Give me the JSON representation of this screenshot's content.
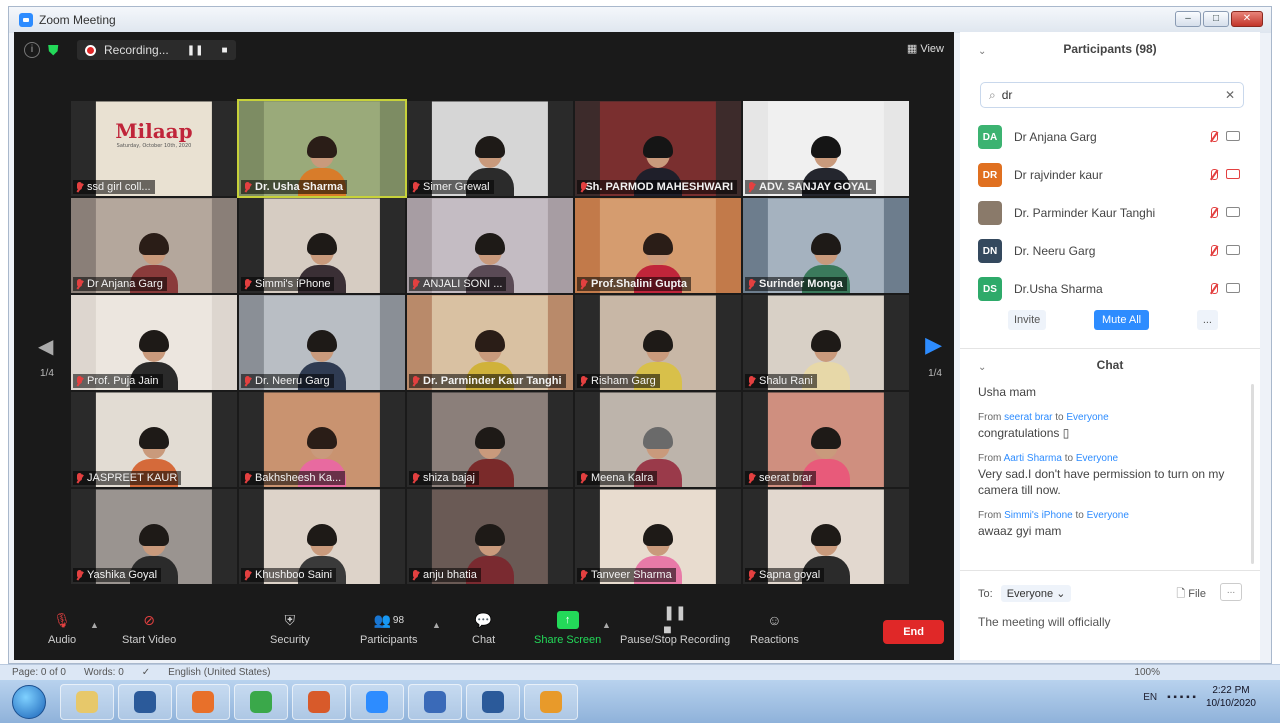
{
  "window": {
    "title": "Zoom Meeting"
  },
  "topbar": {
    "recording_label": "Recording...",
    "view_label": "View"
  },
  "grid": {
    "page_left": "1/4",
    "page_right": "1/4",
    "tiles": [
      {
        "name": "ssd girl coll...",
        "bold": false,
        "active": false,
        "bg": "#2a2a2a",
        "photo": "#e9e1d2",
        "body": "#b84c7c",
        "hair": "#2a1d17",
        "poster_text": "Milaap",
        "poster_sub": "Saturday, October 10th, 2020"
      },
      {
        "name": "Dr. Usha Sharma",
        "bold": true,
        "active": true,
        "bg": "#7d8c63",
        "photo": "#9aaa7a",
        "body": "#d87c2a",
        "hair": "#2a1d17"
      },
      {
        "name": "Simer Grewal",
        "bold": false,
        "active": false,
        "bg": "#2a2a2a",
        "photo": "#d6d6d6",
        "body": "#2b2b2b",
        "hair": "#1e1a17"
      },
      {
        "name": "Sh. PARMOD MAHESHWARI",
        "bold": true,
        "active": false,
        "bg": "#3d2b2b",
        "photo": "#7a2f2f",
        "body": "#1f1f2a",
        "hair": "#151515"
      },
      {
        "name": "ADV. SANJAY GOYAL",
        "bold": true,
        "active": false,
        "bg": "#e6e6e6",
        "photo": "#f0f0f0",
        "body": "#24262e",
        "hair": "#151515"
      },
      {
        "name": "Dr Anjana Garg",
        "bold": false,
        "active": false,
        "bg": "#8a7f78",
        "photo": "#b4a79c",
        "body": "#8a3b3b",
        "hair": "#2a1d17"
      },
      {
        "name": "Simmi's iPhone",
        "bold": false,
        "active": false,
        "bg": "#2a2a2a",
        "photo": "#d6ccc2",
        "body": "#3a2f35",
        "hair": "#1e1a17"
      },
      {
        "name": "ANJALI SONI ...",
        "bold": false,
        "active": false,
        "bg": "#a79da3",
        "photo": "#c4bcc3",
        "body": "#5a4a55",
        "hair": "#1e1a17"
      },
      {
        "name": "Prof.Shalini Gupta",
        "bold": true,
        "active": false,
        "bg": "#c27a4a",
        "photo": "#d59c6f",
        "body": "#c0253a",
        "hair": "#2a1d17"
      },
      {
        "name": "Surinder Monga",
        "bold": true,
        "active": false,
        "bg": "#6d7d8d",
        "photo": "#a5b2bf",
        "body": "#3b7a5c",
        "hair": "#1e1a17"
      },
      {
        "name": "Prof. Puja Jain",
        "bold": false,
        "active": false,
        "bg": "#ddd6cf",
        "photo": "#ece6df",
        "body": "#2a2a2a",
        "hair": "#1e1a17"
      },
      {
        "name": "Dr. Neeru Garg",
        "bold": false,
        "active": false,
        "bg": "#8a8f96",
        "photo": "#b9bec4",
        "body": "#2f3b52",
        "hair": "#1e1a17"
      },
      {
        "name": "Dr. Parminder Kaur Tanghi",
        "bold": true,
        "active": false,
        "bg": "#b98a6a",
        "photo": "#d9c1a2",
        "body": "#d0b23a",
        "hair": "#2a1d17"
      },
      {
        "name": "Risham Garg",
        "bold": false,
        "active": false,
        "bg": "#2a2a2a",
        "photo": "#c8b7a6",
        "body": "#d8c04a",
        "hair": "#1e1a17"
      },
      {
        "name": "Shalu Rani",
        "bold": false,
        "active": false,
        "bg": "#2a2a2a",
        "photo": "#d8d0c6",
        "body": "#e7d8a8",
        "hair": "#1e1a17"
      },
      {
        "name": "JASPREET KAUR",
        "bold": false,
        "active": false,
        "bg": "#2a2a2a",
        "photo": "#e2dcd3",
        "body": "#d56a3a",
        "hair": "#1e1a17"
      },
      {
        "name": "Bakhsheesh Ka...",
        "bold": false,
        "active": false,
        "bg": "#2a2a2a",
        "photo": "#c99370",
        "body": "#e86aa0",
        "hair": "#2a1d17"
      },
      {
        "name": "shiza bajaj",
        "bold": false,
        "active": false,
        "bg": "#2a2a2a",
        "photo": "#8b7f7a",
        "body": "#7a2a2a",
        "hair": "#1e1a17"
      },
      {
        "name": "Meena Kalra",
        "bold": false,
        "active": false,
        "bg": "#2a2a2a",
        "photo": "#bdb4ab",
        "body": "#9a3a4a",
        "hair": "#6a6a6a"
      },
      {
        "name": "seerat brar",
        "bold": false,
        "active": false,
        "bg": "#2a2a2a",
        "photo": "#cf8f7f",
        "body": "#e85a7a",
        "hair": "#1e1a17"
      },
      {
        "name": "Yashika Goyal",
        "bold": false,
        "active": false,
        "bg": "#2a2a2a",
        "photo": "#9a9490",
        "body": "#2b2b2b",
        "hair": "#1e1a17"
      },
      {
        "name": "Khushboo Saini",
        "bold": false,
        "active": false,
        "bg": "#2a2a2a",
        "photo": "#ddd3c9",
        "body": "#3a3a3a",
        "hair": "#1e1a17"
      },
      {
        "name": "anju bhatia",
        "bold": false,
        "active": false,
        "bg": "#2a2a2a",
        "photo": "#6a5a55",
        "body": "#7a2a30",
        "hair": "#1e1a17"
      },
      {
        "name": "Tanveer Sharma",
        "bold": false,
        "active": false,
        "bg": "#2a2a2a",
        "photo": "#e8dccf",
        "body": "#e87aa8",
        "hair": "#1e1a17"
      },
      {
        "name": "Sapna goyal",
        "bold": false,
        "active": false,
        "bg": "#2a2a2a",
        "photo": "#e2d8cf",
        "body": "#2b2b2b",
        "hair": "#1e1a17"
      }
    ]
  },
  "toolbar": {
    "audio": "Audio",
    "start_video": "Start Video",
    "security": "Security",
    "participants": "Participants",
    "participants_count": "98",
    "chat": "Chat",
    "share_screen": "Share Screen",
    "pause_stop_recording": "Pause/Stop Recording",
    "reactions": "Reactions",
    "end": "End"
  },
  "participants_panel": {
    "title": "Participants (98)",
    "search_value": "dr",
    "items": [
      {
        "initials": "DA",
        "color": "#3cb371",
        "name": "Dr Anjana Garg",
        "cam_off": false
      },
      {
        "initials": "DR",
        "color": "#e07020",
        "name": "Dr rajvinder kaur",
        "cam_off": true
      },
      {
        "initials": "",
        "color": "#8a7a6a",
        "name": "Dr.  Parminder Kaur Tanghi",
        "cam_off": false
      },
      {
        "initials": "DN",
        "color": "#34495e",
        "name": "Dr. Neeru Garg",
        "cam_off": false
      },
      {
        "initials": "DS",
        "color": "#2eaa6a",
        "name": "Dr.Usha Sharma",
        "cam_off": false
      }
    ],
    "invite": "Invite",
    "mute_all": "Mute All",
    "more": "..."
  },
  "chat_panel": {
    "title": "Chat",
    "messages": [
      {
        "from": "",
        "to": "",
        "text": "Usha mam"
      },
      {
        "from": "seerat brar",
        "to": "Everyone",
        "text": "congratulations ▯"
      },
      {
        "from": "Aarti  Sharma",
        "to": "Everyone",
        "text": "Very sad.I don't have permission to turn on my camera till now."
      },
      {
        "from": "Simmi's iPhone",
        "to": "Everyone",
        "text": "awaaz gyi mam"
      }
    ],
    "from_prefix": "From",
    "to_word": "to",
    "to_label": "To:",
    "to_value": "Everyone",
    "file_label": "File",
    "more": "...",
    "draft": "The meeting will officially"
  },
  "word_status": {
    "page": "Page: 0 of 0",
    "words": "Words: 0",
    "language": "English (United States)",
    "zoom": "100%"
  },
  "taskbar": {
    "lang": "EN",
    "time": "2:22 PM",
    "date": "10/10/2020",
    "apps": [
      "#e7c86a",
      "#2b5a9a",
      "#e8702a",
      "#3aa84a",
      "#d85a2a",
      "#2d8cff",
      "#3a6ab8",
      "#2b5a9a",
      "#e89a2a"
    ]
  }
}
